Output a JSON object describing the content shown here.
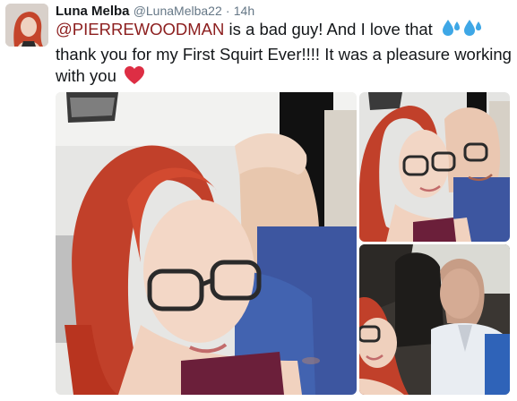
{
  "tweet": {
    "author_name": "Luna Melba",
    "handle": "@LunaMelba22",
    "separator": "·",
    "time": "14h",
    "mention": "@PIERREWOODMAN",
    "text_after_mention": " is a bad guy! And I love that",
    "text_line2": "thank you for my First Squirt Ever!!!! It was a pleasure working",
    "text_line3": "with you",
    "emoji_1": "sweat-droplets-icon",
    "emoji_2": "red-heart-icon"
  },
  "colors": {
    "mention": "#8c1e1e",
    "muted": "#657786",
    "text": "#14171a",
    "droplets": "#3ea7e6",
    "heart": "#dd2e44"
  },
  "photos": [
    {
      "name": "selfie-main",
      "description_icon": "photo"
    },
    {
      "name": "selfie-top-right",
      "description_icon": "photo"
    },
    {
      "name": "car-selfie-bottom-right",
      "description_icon": "photo"
    }
  ]
}
